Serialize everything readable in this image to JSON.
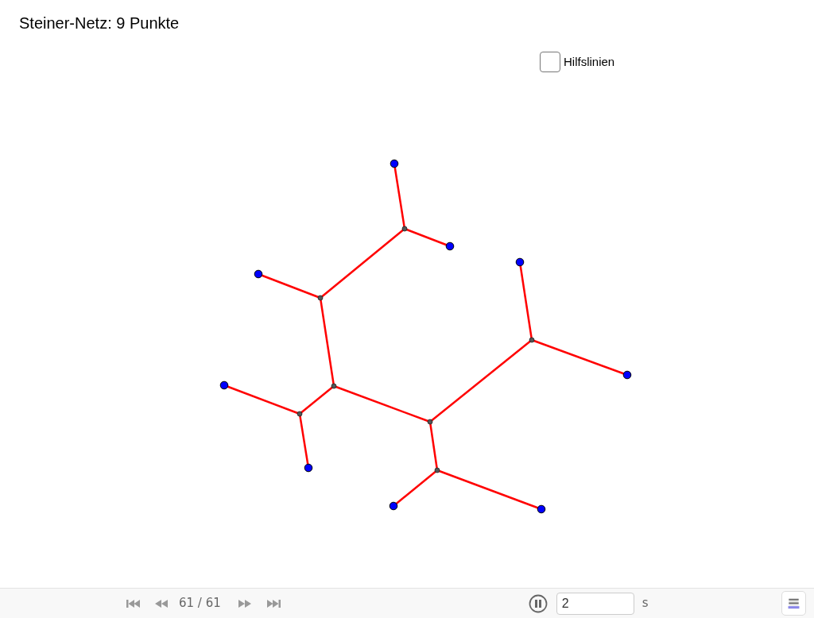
{
  "title": "Steiner-Netz: 9 Punkte",
  "checkbox": {
    "label": "Hilfslinien",
    "checked": false
  },
  "player": {
    "frame": "61 / 61",
    "playing": true,
    "speed": "2",
    "unit": "s"
  }
}
